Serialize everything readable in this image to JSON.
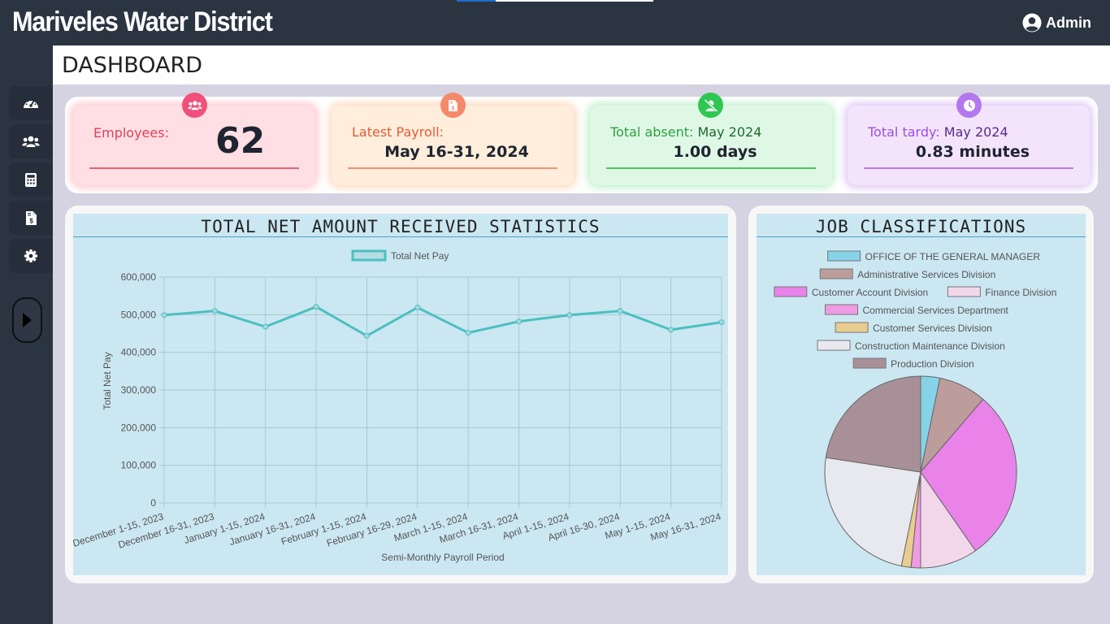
{
  "app": {
    "title": "Mariveles Water District"
  },
  "user": {
    "name": "Admin",
    "icon": "user-circle-icon"
  },
  "page": {
    "title": "DASHBOARD"
  },
  "sidebar": {
    "items": [
      {
        "icon": "dashboard-gauge-icon"
      },
      {
        "icon": "users-icon"
      },
      {
        "icon": "calculator-icon"
      },
      {
        "icon": "payroll-document-icon"
      },
      {
        "icon": "gear-icon"
      }
    ],
    "toggle_icon": "play-right-icon"
  },
  "stats": {
    "employees": {
      "label": "Employees:",
      "value": "62",
      "icon": "users-icon",
      "color": "#e94f72"
    },
    "payroll": {
      "label": "Latest Payroll:",
      "value": "May 16-31, 2024",
      "icon": "payroll-document-icon",
      "color": "#f5845c"
    },
    "absent": {
      "label": "Total absent:",
      "period": "May 2024",
      "value": "1.00 days",
      "icon": "user-slash-icon",
      "color": "#2fc14f"
    },
    "tardy": {
      "label": "Total tardy:",
      "period": "May 2024",
      "value": "0.83 minutes",
      "icon": "clock-icon",
      "color": "#a566e8"
    }
  },
  "net_chart": {
    "title": "TOTAL NET AMOUNT RECEIVED STATISTICS",
    "chart_data": {
      "type": "line",
      "x": [
        "December 1-15, 2023",
        "December 16-31, 2023",
        "January 1-15, 2024",
        "January 16-31, 2024",
        "February 1-15, 2024",
        "February 16-29, 2024",
        "March 1-15, 2024",
        "March 16-31, 2024",
        "April 1-15, 2024",
        "April 16-30, 2024",
        "May 1-15, 2024",
        "May 16-31, 2024"
      ],
      "series": [
        {
          "name": "Total Net Pay",
          "values": [
            499000,
            510000,
            468000,
            521000,
            444000,
            519000,
            452000,
            482000,
            499000,
            510000,
            460000,
            480000
          ]
        }
      ],
      "xlabel": "Semi-Monthly Payroll Period",
      "ylabel": "Total Net Pay",
      "ylim": [
        0,
        600000
      ],
      "yticks": [
        "600,000",
        "500,000",
        "400,000",
        "300,000",
        "200,000",
        "100,000",
        "0"
      ],
      "grid": true,
      "legend": "top",
      "color": "#4bc0c0"
    }
  },
  "job_chart": {
    "title": "JOB CLASSIFICATIONS",
    "chart_data": {
      "type": "pie",
      "categories": [
        "OFFICE OF THE GENERAL MANAGER",
        "Administrative Services Division",
        "Customer Account Division",
        "Finance Division",
        "Commercial Services Department",
        "Customer Services Division",
        "Construction Maintenance Division",
        "Production Division"
      ],
      "values": [
        2,
        5,
        18,
        6,
        1,
        1,
        15,
        14
      ],
      "colors": [
        "#86d3e8",
        "#bd9c9c",
        "#e983ea",
        "#f2d7ea",
        "#ef9be2",
        "#e8cd8f",
        "#e8e9ee",
        "#a99098"
      ],
      "legend": "top"
    }
  }
}
